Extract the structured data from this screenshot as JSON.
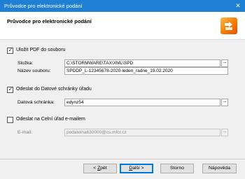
{
  "window": {
    "title": "Průvodce pro elektronické podání"
  },
  "header": {
    "title": "Průvodce pro elektronické podání"
  },
  "pdf": {
    "checkbox_label": "Uložit PDF do souboru",
    "checked": true,
    "folder_label": "Složka:",
    "folder_value": "C:\\STORMWARE\\TAX\\XML\\SPD",
    "filename_label": "Název souboru:",
    "filename_value": "SPDDP_L-12345678-2020-leden_radne_19.02.2020"
  },
  "databox": {
    "checkbox_label": "Odeslat do Datové schránky úřadu",
    "checked": true,
    "field_label": "Datová schránka:",
    "field_value": "edynz54"
  },
  "email": {
    "checkbox_label": "Odeslat na Celní úřad e-mailem",
    "checked": false,
    "field_label": "E-mail:",
    "field_value": "podatelna630000@cs.mfcr.cz"
  },
  "buttons": {
    "back_pre": "< ",
    "back_u": "Z",
    "back_post": "pět",
    "next_u": "D",
    "next_post": "alší >",
    "cancel": "Storno",
    "help": "Nápověda"
  },
  "glyphs": {
    "ellipsis": "...",
    "check": "✓",
    "close": "✕"
  }
}
